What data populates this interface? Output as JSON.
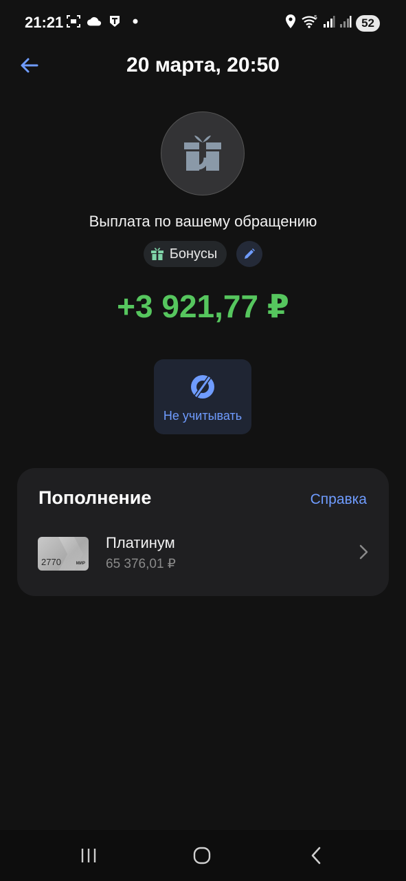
{
  "status_bar": {
    "time": "21:21",
    "left_icons": [
      "screenshot-icon",
      "cloud-icon",
      "app-t-icon",
      "dot-icon"
    ],
    "right_icons": [
      "location-icon",
      "wifi-icon",
      "signal-icon",
      "signal-icon"
    ],
    "battery": "52"
  },
  "header": {
    "title": "20 марта, 20:50"
  },
  "transaction": {
    "icon": "gift-icon",
    "description": "Выплата по вашему обращению",
    "category": "Бонусы",
    "amount": "+3 921,77 ₽",
    "amount_color": "#56c65e"
  },
  "actions": [
    {
      "label": "Не учитывать",
      "icon": "exclude-icon"
    }
  ],
  "section": {
    "title": "Пополнение",
    "help_link": "Справка",
    "account": {
      "card_last_digits": "2770",
      "card_brand": "МИР",
      "name": "Платинум",
      "balance": "65 376,01 ₽"
    }
  },
  "colors": {
    "accent": "#6f9cff",
    "background": "#121212",
    "card": "#1f1f21"
  }
}
